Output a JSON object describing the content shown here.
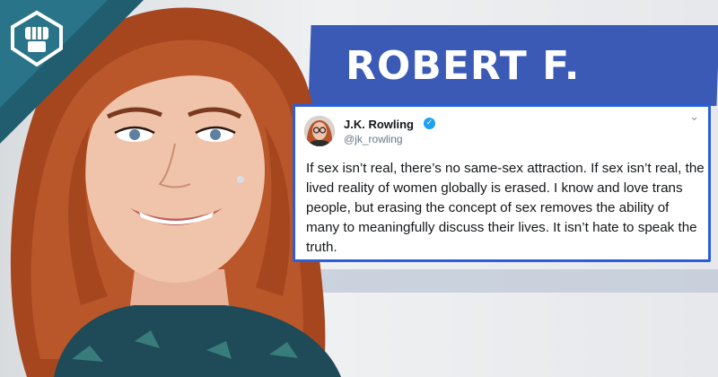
{
  "backdrop": {
    "banner_text": "ROBERT F."
  },
  "tweet": {
    "author_name": "J.K. Rowling",
    "handle": "@jk_rowling",
    "verified_mark": "✓",
    "menu_icon": "chevron-down-icon",
    "chevron": "⌄",
    "text": "If sex isn’t real, there’s no same-sex attraction. If sex isn’t real, the lived reality of women globally is erased. I know and love trans people, but erasing the concept of sex removes the ability of many to meaningfully discuss their lives. It isn’t hate to speak the truth."
  },
  "colors": {
    "tweet_border": "#2b5fd9",
    "banner": "#3b5ab6",
    "hair": "#b5532a",
    "verified": "#1da1f2"
  }
}
